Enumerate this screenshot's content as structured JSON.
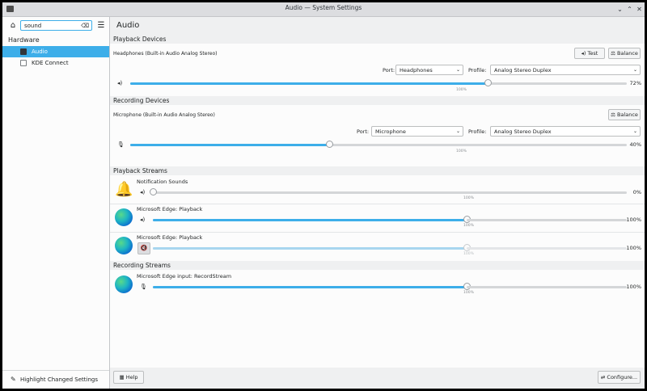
{
  "window": {
    "title": "Audio — System Settings"
  },
  "sidebar": {
    "search_value": "sound",
    "category": "Hardware",
    "items": [
      {
        "label": "Audio",
        "selected": true
      },
      {
        "label": "KDE Connect",
        "selected": false
      }
    ],
    "highlight_label": "Highlight Changed Settings"
  },
  "page": {
    "title": "Audio"
  },
  "playback_devices": {
    "section": "Playback Devices",
    "device_label": "Headphones (Built-in Audio Analog Stereo)",
    "test_label": "Test",
    "balance_label": "Balance",
    "port_label": "Port:",
    "port_value": "Headphones",
    "profile_label": "Profile:",
    "profile_value": "Analog Stereo Duplex",
    "volume": 72,
    "volume_text": "72%",
    "mark_text": "100%"
  },
  "recording_devices": {
    "section": "Recording Devices",
    "device_label": "Microphone (Built-in Audio Analog Stereo)",
    "balance_label": "Balance",
    "port_label": "Port:",
    "port_value": "Microphone",
    "profile_label": "Profile:",
    "profile_value": "Analog Stereo Duplex",
    "volume": 40,
    "volume_text": "40%",
    "mark_text": "100%"
  },
  "playback_streams": {
    "section": "Playback Streams",
    "items": [
      {
        "name": "Notification Sounds",
        "volume": 0,
        "volume_text": "0%",
        "mark_text": "100%",
        "icon": "bell-icon",
        "muted": false
      },
      {
        "name": "Microsoft Edge: Playback",
        "volume": 100,
        "volume_text": "100%",
        "mark_text": "100%",
        "icon": "edge-icon",
        "muted": false
      },
      {
        "name": "Microsoft Edge: Playback",
        "volume": 100,
        "volume_text": "100%",
        "mark_text": "100%",
        "icon": "edge-icon",
        "muted": true
      }
    ]
  },
  "recording_streams": {
    "section": "Recording Streams",
    "items": [
      {
        "name": "Microsoft Edge input: RecordStream",
        "volume": 100,
        "volume_text": "100%",
        "mark_text": "100%",
        "icon": "edge-icon"
      }
    ]
  },
  "footer": {
    "configure_label": "Configure...",
    "help_label": "Help"
  },
  "colors": {
    "accent": "#3daee9"
  }
}
